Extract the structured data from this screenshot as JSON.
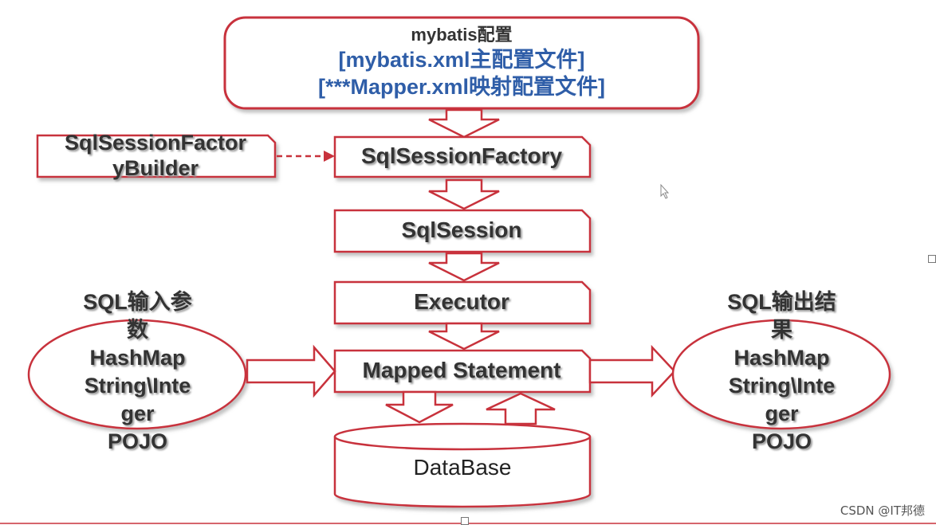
{
  "config": {
    "title": "mybatis配置",
    "line1": "[mybatis.xml主配置文件]",
    "line2": "[***Mapper.xml映射配置文件]"
  },
  "builder": {
    "line1": "SqlSessionFactor",
    "line2": "yBuilder"
  },
  "factory": "SqlSessionFactory",
  "session": "SqlSession",
  "executor": "Executor",
  "mapped": "Mapped Statement",
  "database": "DataBase",
  "input": {
    "lines": [
      "SQL输入参",
      "数",
      "HashMap",
      "String\\Inte",
      "ger",
      "POJO"
    ]
  },
  "output": {
    "lines": [
      "SQL输出结",
      "果",
      "HashMap",
      "String\\Inte",
      "ger",
      "POJO"
    ]
  },
  "watermark": "CSDN @IT邦德",
  "colors": {
    "stroke": "#c8323c",
    "text": "#333333",
    "blue": "#2f5ea8"
  }
}
